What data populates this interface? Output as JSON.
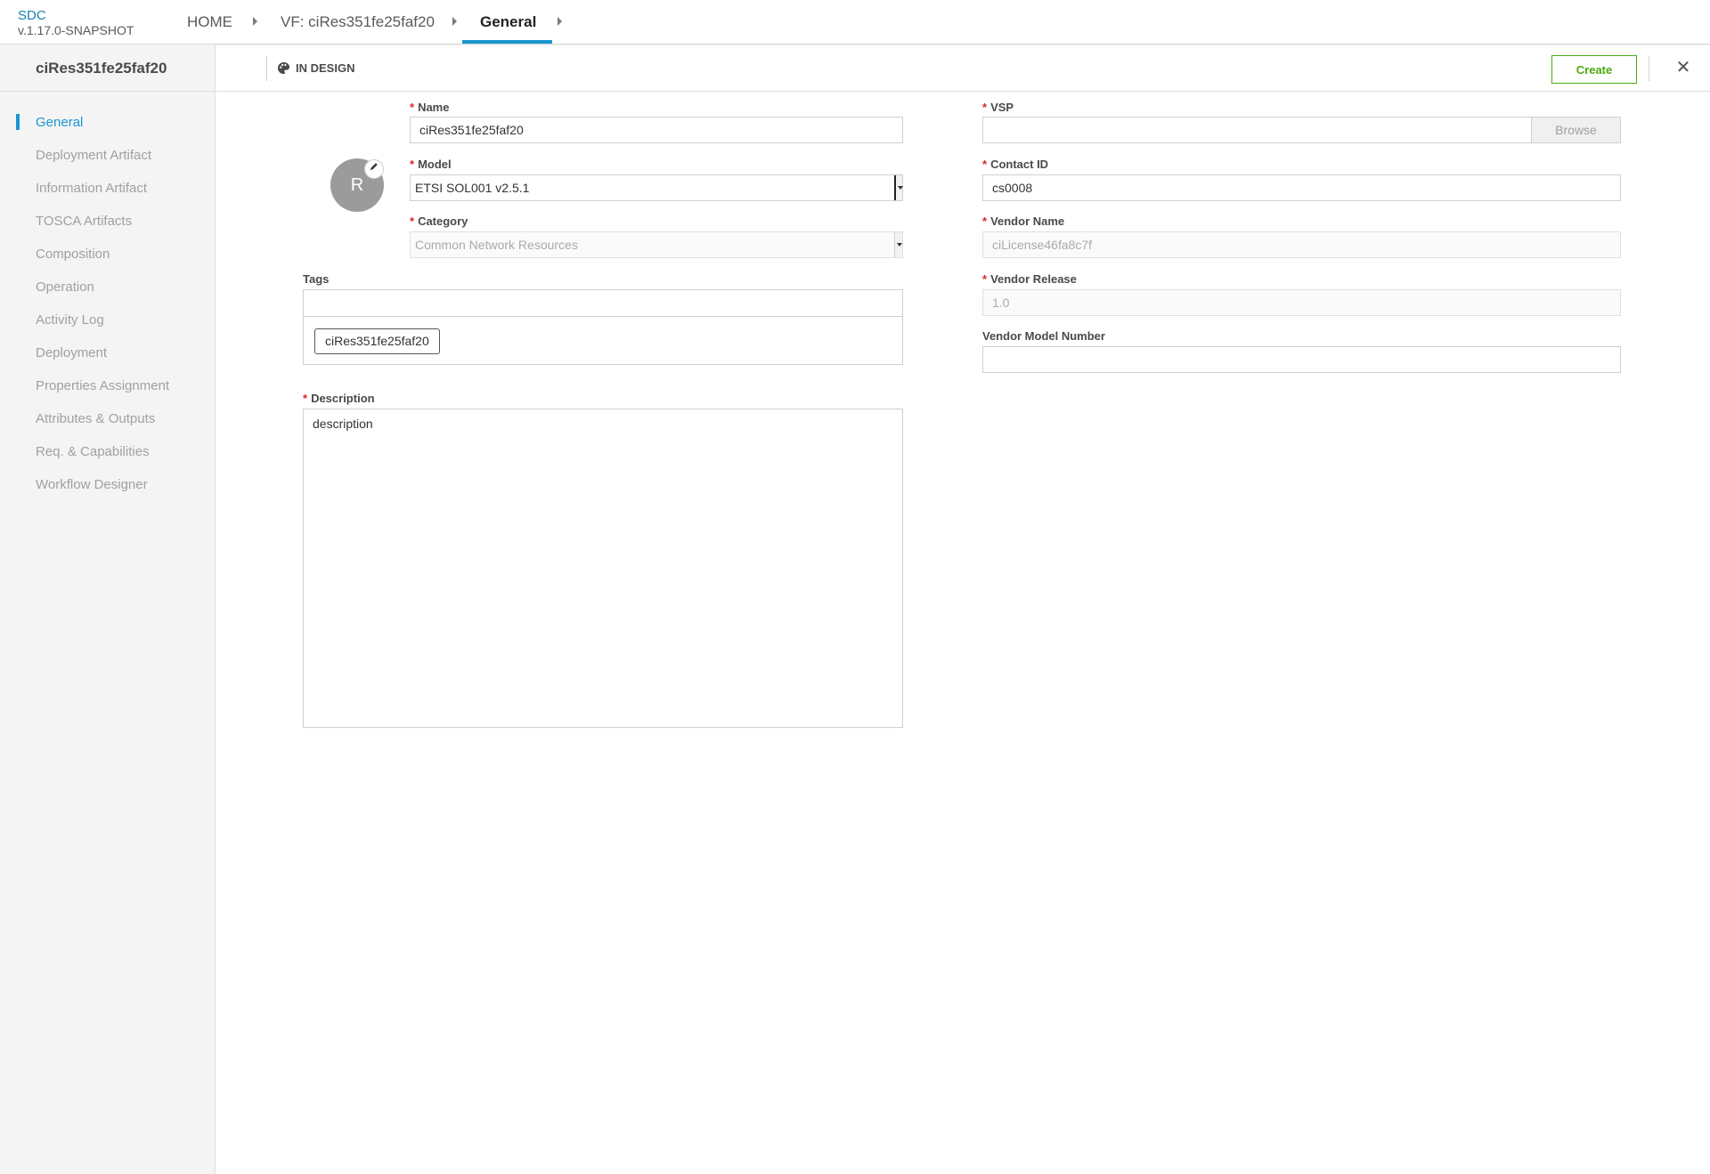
{
  "app": {
    "name": "SDC",
    "version": "v.1.17.0-SNAPSHOT"
  },
  "breadcrumb": {
    "home": "HOME",
    "vf": "VF: ciRes351fe25faf20",
    "current": "General"
  },
  "sidebar": {
    "title": "ciRes351fe25faf20",
    "items": [
      {
        "label": "General"
      },
      {
        "label": "Deployment Artifact"
      },
      {
        "label": "Information Artifact"
      },
      {
        "label": "TOSCA Artifacts"
      },
      {
        "label": "Composition"
      },
      {
        "label": "Operation"
      },
      {
        "label": "Activity Log"
      },
      {
        "label": "Deployment"
      },
      {
        "label": "Properties Assignment"
      },
      {
        "label": "Attributes & Outputs"
      },
      {
        "label": "Req. & Capabilities"
      },
      {
        "label": "Workflow Designer"
      }
    ]
  },
  "header": {
    "status": "IN DESIGN",
    "create_label": "Create",
    "close_glyph": "✕"
  },
  "avatar": {
    "letter": "R",
    "edit_icon": "pencil-icon"
  },
  "form": {
    "required_mark": "*",
    "name": {
      "label": "Name",
      "value": "ciRes351fe25faf20"
    },
    "model": {
      "label": "Model",
      "value": "ETSI SOL001 v2.5.1"
    },
    "category": {
      "label": "Category",
      "value": "Common Network Resources"
    },
    "tags": {
      "label": "Tags",
      "items": [
        "ciRes351fe25faf20"
      ]
    },
    "description": {
      "label": "Description",
      "value": "description"
    },
    "vsp": {
      "label": "VSP",
      "value": "",
      "browse_label": "Browse"
    },
    "contact_id": {
      "label": "Contact ID",
      "value": "cs0008"
    },
    "vendor_name": {
      "label": "Vendor Name",
      "value": "ciLicense46fa8c7f"
    },
    "vendor_release": {
      "label": "Vendor Release",
      "value": "1.0"
    },
    "vendor_model_number": {
      "label": "Vendor Model Number",
      "value": ""
    }
  },
  "colors": {
    "accent": "#1a96d1",
    "create": "#4ca90c",
    "required": "#d9262b"
  }
}
